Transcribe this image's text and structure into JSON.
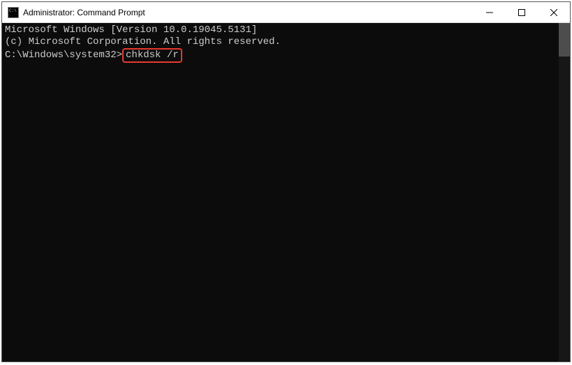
{
  "titlebar": {
    "title": "Administrator: Command Prompt"
  },
  "terminal": {
    "line1": "Microsoft Windows [Version 10.0.19045.5131]",
    "line2": "(c) Microsoft Corporation. All rights reserved.",
    "blank": "",
    "prompt": "C:\\Windows\\system32>",
    "command": "chkdsk /r"
  }
}
